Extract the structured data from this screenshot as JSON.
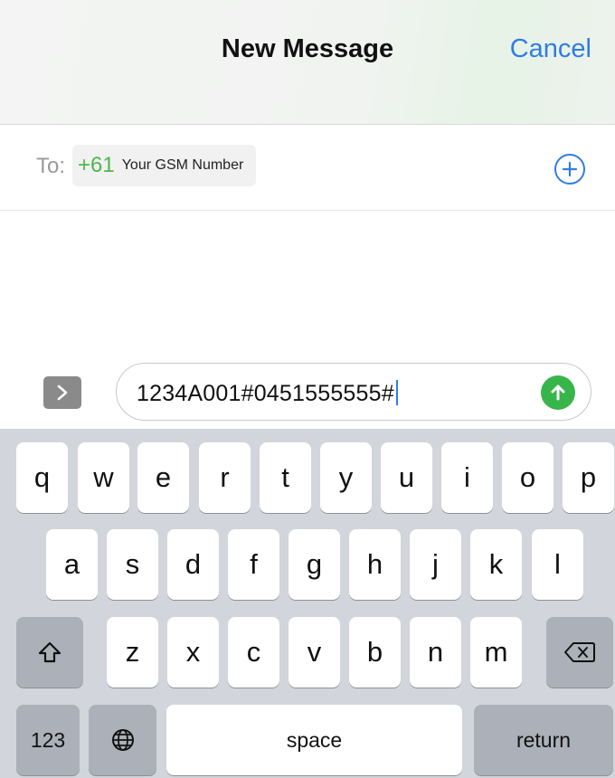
{
  "nav": {
    "title": "New Message",
    "cancel": "Cancel"
  },
  "recipient": {
    "label": "To:",
    "country_code": "+61",
    "name": "Your GSM Number"
  },
  "composer": {
    "text": "1234A001#0451555555#"
  },
  "keyboard": {
    "row1": [
      "q",
      "w",
      "e",
      "r",
      "t",
      "y",
      "u",
      "i",
      "o",
      "p"
    ],
    "row2": [
      "a",
      "s",
      "d",
      "f",
      "g",
      "h",
      "j",
      "k",
      "l"
    ],
    "row3": [
      "z",
      "x",
      "c",
      "v",
      "b",
      "n",
      "m"
    ],
    "numbers": "123",
    "space": "space",
    "return": "return"
  },
  "colors": {
    "accent_blue": "#2f7de1",
    "send_green": "#38b54a",
    "country_code_green": "#4db84a",
    "keyboard_bg": "#d2d5db"
  },
  "icons": {
    "add_contact": "plus-circle-icon",
    "apps": "chevron-right-icon",
    "send": "arrow-up-icon",
    "shift": "shift-icon",
    "globe": "globe-icon",
    "delete": "backspace-icon"
  }
}
